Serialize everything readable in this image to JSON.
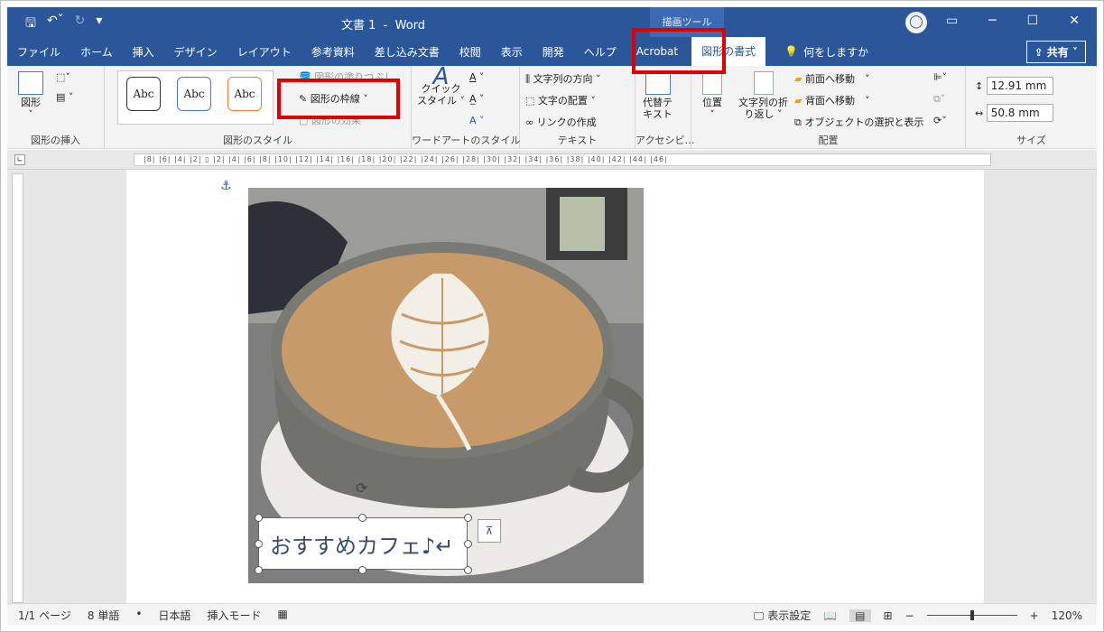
{
  "titlebar": {
    "title": "文書 1  -  Word",
    "tool_context": "描画ツール",
    "avatar_glyph": "👤"
  },
  "tabs": [
    "ファイル",
    "ホーム",
    "挿入",
    "デザイン",
    "レイアウト",
    "参考資料",
    "差し込み文書",
    "校閲",
    "表示",
    "開発",
    "ヘルプ",
    "Acrobat"
  ],
  "active_tab": "図形の書式",
  "help_search": "何をしますか",
  "share": "共有",
  "ribbon": {
    "insert_shapes": {
      "label": "図形",
      "group": "図形の挿入"
    },
    "shape_styles": {
      "group": "図形のスタイル",
      "abc": [
        "Abc",
        "Abc",
        "Abc"
      ],
      "fill": "図形の塗りつぶし",
      "outline": "図形の枠線",
      "effects": "図形の効果"
    },
    "wordart": {
      "quick_style": "クイック",
      "quick_style2": "スタイル",
      "group": "ワードアートのスタイル"
    },
    "text": {
      "direction": "文字列の方向",
      "align": "文字の配置",
      "link": "リンクの作成",
      "group": "テキスト"
    },
    "access": {
      "alt1": "代替テ",
      "alt2": "キスト",
      "group": "アクセシビ…"
    },
    "arrange": {
      "position": "位置",
      "wrap1": "文字列の折",
      "wrap2": "り返し",
      "forward": "前面へ移動",
      "backward": "背面へ移動",
      "pane": "オブジェクトの選択と表示",
      "group": "配置"
    },
    "size": {
      "height": "12.91 mm",
      "width": "50.8 mm",
      "group": "サイズ"
    }
  },
  "ruler_text": "|8|  |6|  |4|  |2|  ▯  |2|  |4|  |6|  |8|  |10|  |12|  |14|  |16|  |18|  |20|  |22|  |24|  |26|  |28|  |30|  |32|  |34|  |36|  |38|  |40|  |42|  |44|  |46|",
  "textbox_text": "おすすめカフェ♪↵",
  "statusbar": {
    "page": "1/1 ページ",
    "words": "8 単語",
    "lang": "日本語",
    "mode": "挿入モード",
    "display": "表示設定",
    "zoom": "120%"
  },
  "colors": {
    "accent": "#2b579a",
    "highlight": "#e00000"
  }
}
